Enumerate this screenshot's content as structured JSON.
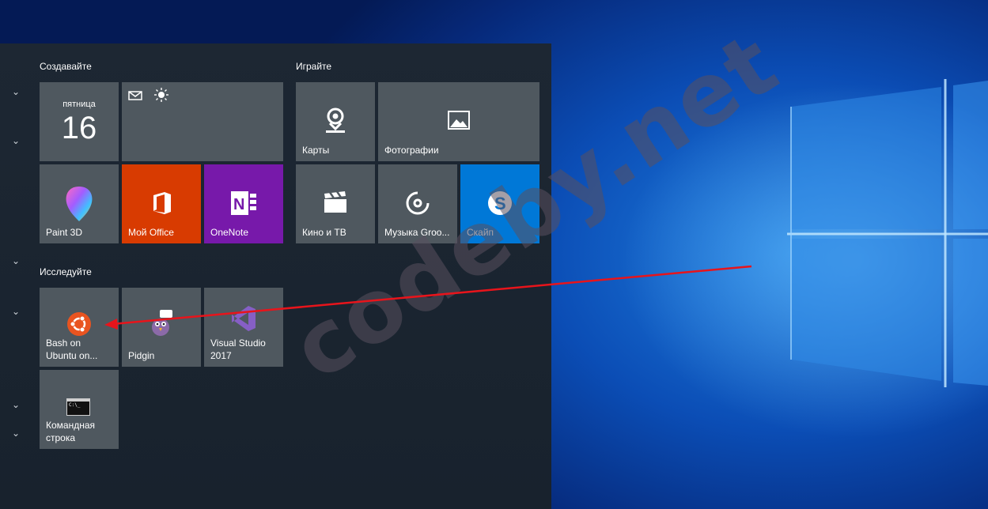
{
  "groups": {
    "create": "Создавайте",
    "play": "Играйте",
    "explore": "Исследуйте"
  },
  "tiles": {
    "calendar": {
      "day_name": "пятница",
      "day_number": "16"
    },
    "maps": "Карты",
    "photos": "Фотографии",
    "paint3d": "Paint 3D",
    "office": "Мой Office",
    "onenote": "OneNote",
    "movies": "Кино и ТВ",
    "music": "Музыка Groo...",
    "skype": "Скайп",
    "bash": "Bash on\nUbuntu on...",
    "pidgin": "Pidgin",
    "visual_studio": "Visual Studio\n2017",
    "cmd": "Командная\nстрока"
  },
  "cmd_icon_text": "C:\\_",
  "watermark": "codeby.net",
  "colors": {
    "tile_gray": "#4f585f",
    "office_orange": "#d83b01",
    "onenote_purple": "#7719aa",
    "skype_blue": "#0078d7",
    "arrow_red": "#e8141b",
    "ubuntu_orange": "#e95420"
  }
}
